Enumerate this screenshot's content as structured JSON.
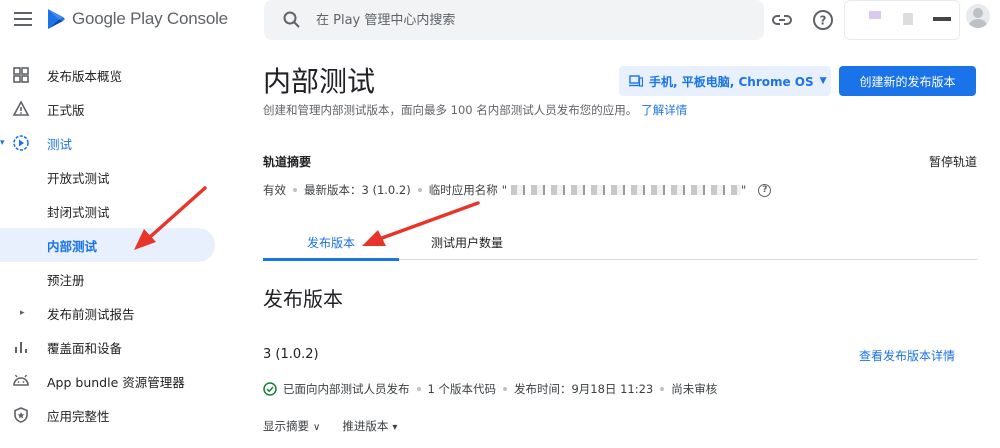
{
  "app": {
    "logo_text": "Google Play Console"
  },
  "search": {
    "placeholder": "在 Play 管理中心内搜索"
  },
  "sidebar": {
    "items": [
      {
        "label": "发布版本概览",
        "icon": "dashboard-icon"
      },
      {
        "label": "正式版",
        "icon": "alert-triangle-icon"
      },
      {
        "label": "测试",
        "icon": "play-circle-icon",
        "state": "active-group"
      },
      {
        "label": "开放式测试"
      },
      {
        "label": "封闭式测试"
      },
      {
        "label": "内部测试",
        "state": "selected"
      },
      {
        "label": "预注册"
      },
      {
        "label": "发布前测试报告",
        "icon": "caret-right-icon"
      },
      {
        "label": "覆盖面和设备",
        "icon": "bar-chart-icon"
      },
      {
        "label": "App bundle 资源管理器",
        "icon": "android-icon"
      },
      {
        "label": "应用完整性",
        "icon": "shield-icon"
      }
    ]
  },
  "page": {
    "title": "内部测试",
    "subtitle": "创建和管理内部测试版本，面向最多 100 名内部测试人员发布您的应用。",
    "learn_more": "了解详情",
    "device_selector": "手机, 平板电脑, Chrome OS",
    "create_button": "创建新的发布版本"
  },
  "track": {
    "heading": "轨道摘要",
    "pause": "暂停轨道",
    "status": "有效",
    "latest_version": "最新版本：3 (1.0.2)",
    "temp_name_label": "临时应用名称",
    "temp_name_prefix": "\"",
    "temp_name_suffix": "\""
  },
  "tabs": [
    {
      "label": "发布版本",
      "active": true
    },
    {
      "label": "测试用户数量",
      "active": false
    }
  ],
  "releases": {
    "section_title": "发布版本",
    "name": "3 (1.0.2)",
    "details_link": "查看发布版本详情",
    "status_text": "已面向内部测试人员发布",
    "version_codes": "1 个版本代码",
    "release_time": "发布时间：9月18日 11:23",
    "review": "尚未审核",
    "show_summary": "显示摘要",
    "promote": "推进版本"
  },
  "colors": {
    "accent": "#1a73e8",
    "annotation_arrow": "#e8352b"
  }
}
